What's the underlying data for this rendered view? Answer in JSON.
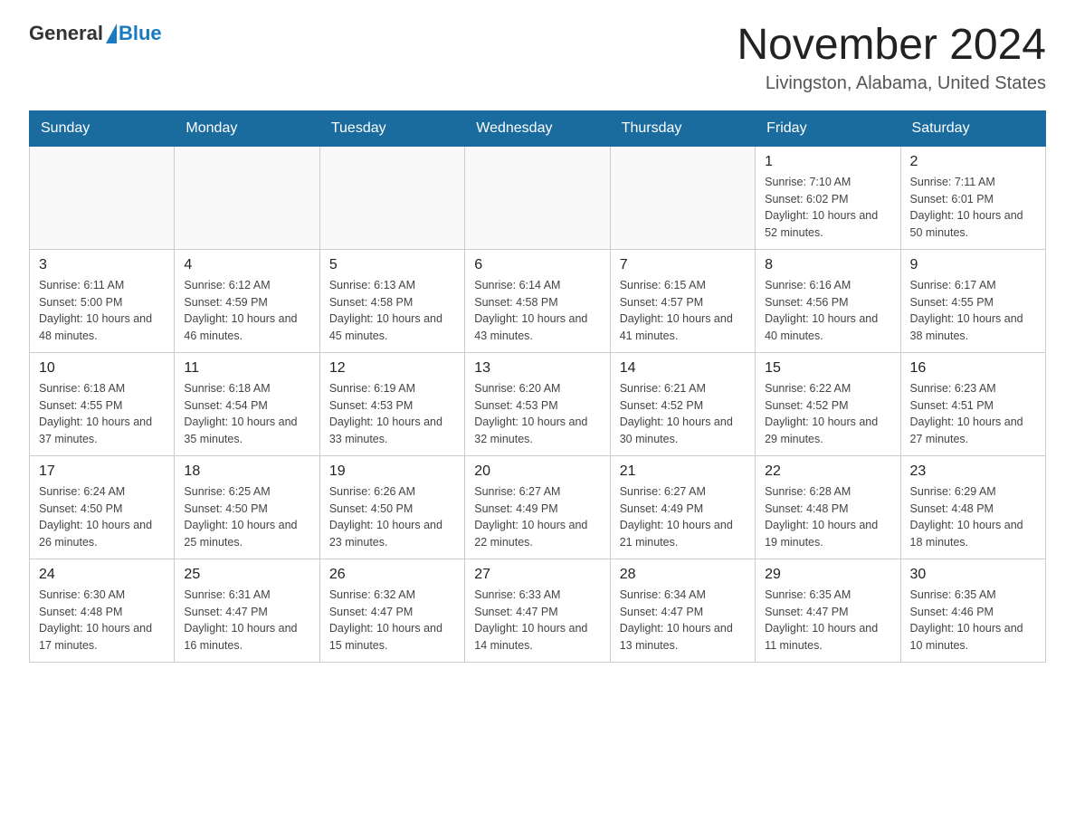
{
  "header": {
    "logo_general": "General",
    "logo_blue": "Blue",
    "title": "November 2024",
    "location": "Livingston, Alabama, United States"
  },
  "weekdays": [
    "Sunday",
    "Monday",
    "Tuesday",
    "Wednesday",
    "Thursday",
    "Friday",
    "Saturday"
  ],
  "weeks": [
    [
      {
        "day": "",
        "info": ""
      },
      {
        "day": "",
        "info": ""
      },
      {
        "day": "",
        "info": ""
      },
      {
        "day": "",
        "info": ""
      },
      {
        "day": "",
        "info": ""
      },
      {
        "day": "1",
        "info": "Sunrise: 7:10 AM\nSunset: 6:02 PM\nDaylight: 10 hours and 52 minutes."
      },
      {
        "day": "2",
        "info": "Sunrise: 7:11 AM\nSunset: 6:01 PM\nDaylight: 10 hours and 50 minutes."
      }
    ],
    [
      {
        "day": "3",
        "info": "Sunrise: 6:11 AM\nSunset: 5:00 PM\nDaylight: 10 hours and 48 minutes."
      },
      {
        "day": "4",
        "info": "Sunrise: 6:12 AM\nSunset: 4:59 PM\nDaylight: 10 hours and 46 minutes."
      },
      {
        "day": "5",
        "info": "Sunrise: 6:13 AM\nSunset: 4:58 PM\nDaylight: 10 hours and 45 minutes."
      },
      {
        "day": "6",
        "info": "Sunrise: 6:14 AM\nSunset: 4:58 PM\nDaylight: 10 hours and 43 minutes."
      },
      {
        "day": "7",
        "info": "Sunrise: 6:15 AM\nSunset: 4:57 PM\nDaylight: 10 hours and 41 minutes."
      },
      {
        "day": "8",
        "info": "Sunrise: 6:16 AM\nSunset: 4:56 PM\nDaylight: 10 hours and 40 minutes."
      },
      {
        "day": "9",
        "info": "Sunrise: 6:17 AM\nSunset: 4:55 PM\nDaylight: 10 hours and 38 minutes."
      }
    ],
    [
      {
        "day": "10",
        "info": "Sunrise: 6:18 AM\nSunset: 4:55 PM\nDaylight: 10 hours and 37 minutes."
      },
      {
        "day": "11",
        "info": "Sunrise: 6:18 AM\nSunset: 4:54 PM\nDaylight: 10 hours and 35 minutes."
      },
      {
        "day": "12",
        "info": "Sunrise: 6:19 AM\nSunset: 4:53 PM\nDaylight: 10 hours and 33 minutes."
      },
      {
        "day": "13",
        "info": "Sunrise: 6:20 AM\nSunset: 4:53 PM\nDaylight: 10 hours and 32 minutes."
      },
      {
        "day": "14",
        "info": "Sunrise: 6:21 AM\nSunset: 4:52 PM\nDaylight: 10 hours and 30 minutes."
      },
      {
        "day": "15",
        "info": "Sunrise: 6:22 AM\nSunset: 4:52 PM\nDaylight: 10 hours and 29 minutes."
      },
      {
        "day": "16",
        "info": "Sunrise: 6:23 AM\nSunset: 4:51 PM\nDaylight: 10 hours and 27 minutes."
      }
    ],
    [
      {
        "day": "17",
        "info": "Sunrise: 6:24 AM\nSunset: 4:50 PM\nDaylight: 10 hours and 26 minutes."
      },
      {
        "day": "18",
        "info": "Sunrise: 6:25 AM\nSunset: 4:50 PM\nDaylight: 10 hours and 25 minutes."
      },
      {
        "day": "19",
        "info": "Sunrise: 6:26 AM\nSunset: 4:50 PM\nDaylight: 10 hours and 23 minutes."
      },
      {
        "day": "20",
        "info": "Sunrise: 6:27 AM\nSunset: 4:49 PM\nDaylight: 10 hours and 22 minutes."
      },
      {
        "day": "21",
        "info": "Sunrise: 6:27 AM\nSunset: 4:49 PM\nDaylight: 10 hours and 21 minutes."
      },
      {
        "day": "22",
        "info": "Sunrise: 6:28 AM\nSunset: 4:48 PM\nDaylight: 10 hours and 19 minutes."
      },
      {
        "day": "23",
        "info": "Sunrise: 6:29 AM\nSunset: 4:48 PM\nDaylight: 10 hours and 18 minutes."
      }
    ],
    [
      {
        "day": "24",
        "info": "Sunrise: 6:30 AM\nSunset: 4:48 PM\nDaylight: 10 hours and 17 minutes."
      },
      {
        "day": "25",
        "info": "Sunrise: 6:31 AM\nSunset: 4:47 PM\nDaylight: 10 hours and 16 minutes."
      },
      {
        "day": "26",
        "info": "Sunrise: 6:32 AM\nSunset: 4:47 PM\nDaylight: 10 hours and 15 minutes."
      },
      {
        "day": "27",
        "info": "Sunrise: 6:33 AM\nSunset: 4:47 PM\nDaylight: 10 hours and 14 minutes."
      },
      {
        "day": "28",
        "info": "Sunrise: 6:34 AM\nSunset: 4:47 PM\nDaylight: 10 hours and 13 minutes."
      },
      {
        "day": "29",
        "info": "Sunrise: 6:35 AM\nSunset: 4:47 PM\nDaylight: 10 hours and 11 minutes."
      },
      {
        "day": "30",
        "info": "Sunrise: 6:35 AM\nSunset: 4:46 PM\nDaylight: 10 hours and 10 minutes."
      }
    ]
  ]
}
